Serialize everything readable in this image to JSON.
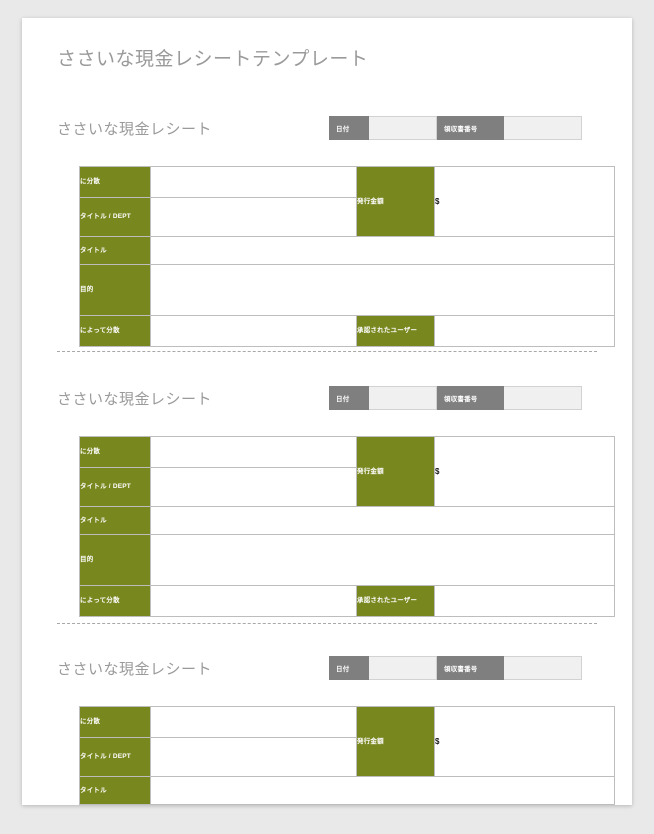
{
  "document": {
    "title": "ささいな現金レシートテンプレート"
  },
  "labels": {
    "date": "日付",
    "receipt_number": "領収書番号",
    "issued_to": "に分散",
    "title_dept": "タイトル / DEPT",
    "title": "タイトル",
    "purpose": "目的",
    "issued_by": "によって分散",
    "amount_issued": "発行金額",
    "approved_by": "承認されたユーザー",
    "currency_symbol": "$"
  },
  "colors": {
    "accent_green": "#79871f",
    "header_gray": "#7f7f7f",
    "field_gray": "#f0f0f0",
    "title_gray": "#9a9a9a",
    "page_background": "#e9e9e9"
  },
  "receipts": [
    {
      "section_title": "ささいな現金レシート",
      "date_value": "",
      "receipt_number_value": "",
      "issued_to_value": "",
      "title_dept_value": "",
      "title_value": "",
      "purpose_value": "",
      "issued_by_value": "",
      "amount_value": "",
      "approved_by_value": ""
    },
    {
      "section_title": "ささいな現金レシート",
      "date_value": "",
      "receipt_number_value": "",
      "issued_to_value": "",
      "title_dept_value": "",
      "title_value": "",
      "purpose_value": "",
      "issued_by_value": "",
      "amount_value": "",
      "approved_by_value": ""
    },
    {
      "section_title": "ささいな現金レシート",
      "date_value": "",
      "receipt_number_value": "",
      "issued_to_value": "",
      "title_dept_value": "",
      "title_value": "",
      "amount_value": ""
    }
  ]
}
